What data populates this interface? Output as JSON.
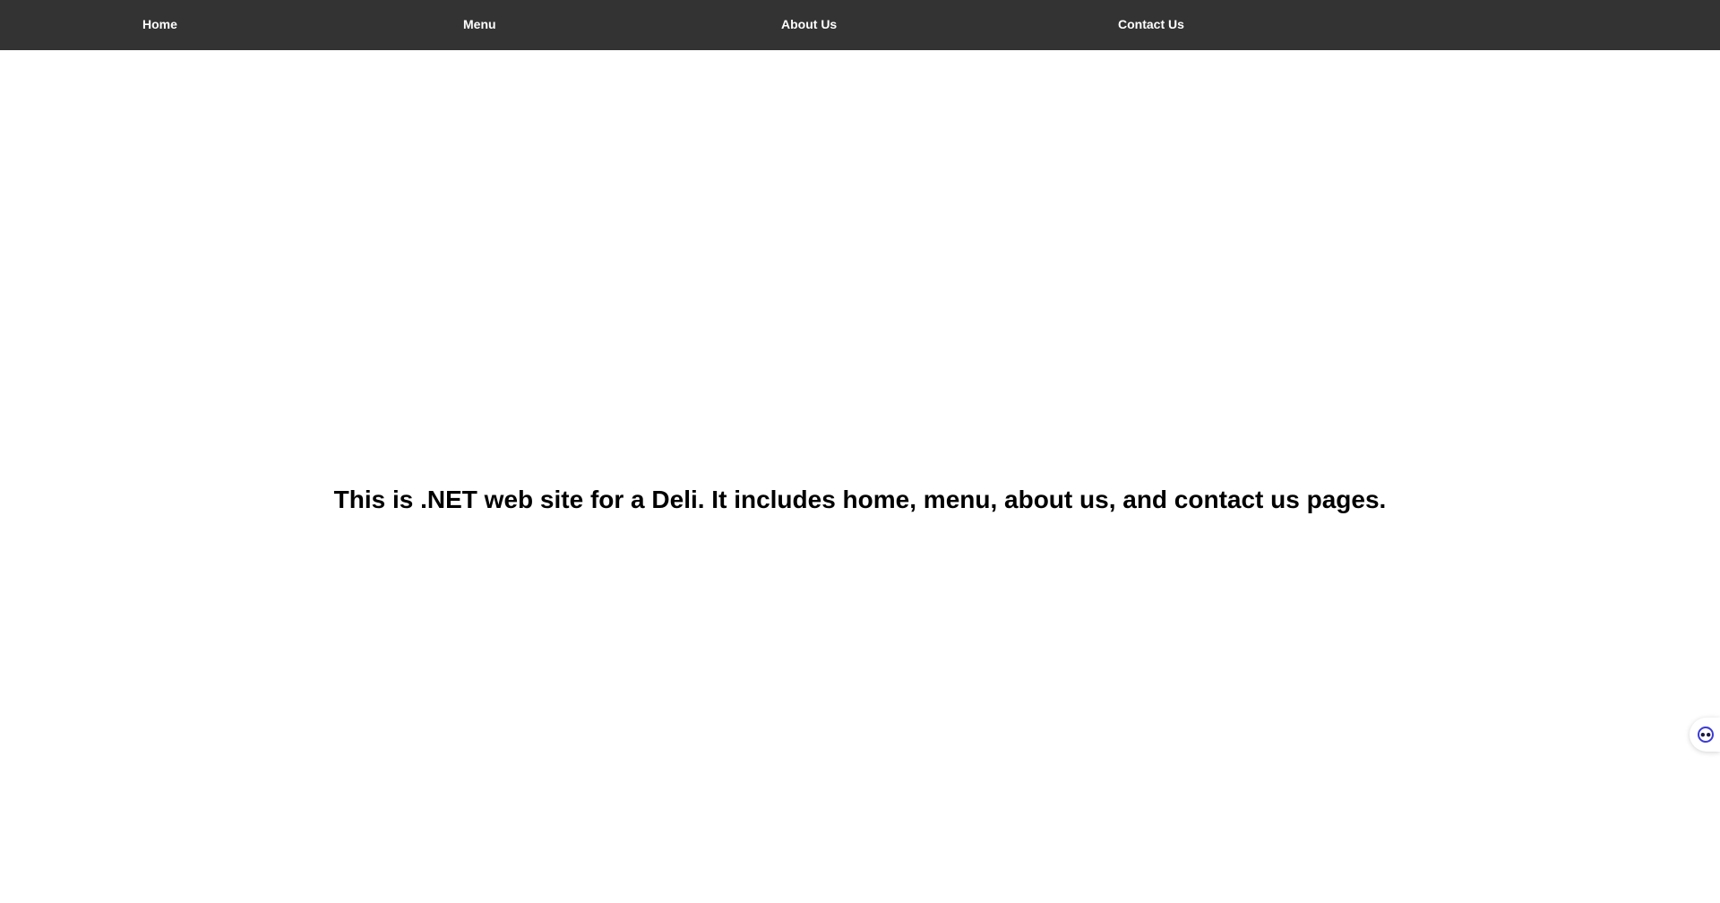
{
  "nav": {
    "home_label": "Home",
    "menu_label": "Menu",
    "about_label": "About Us",
    "contact_label": "Contact Us"
  },
  "main": {
    "intro_text": "This is .NET web site for a Deli. It includes home, menu, about us, and contact us pages."
  },
  "widget": {
    "icon": "assistant-face-icon",
    "accent_color": "#3b3bd6"
  },
  "colors": {
    "navbar_background": "#333333",
    "nav_text": "#ffffff",
    "page_background": "#ffffff",
    "body_text": "#000000"
  }
}
